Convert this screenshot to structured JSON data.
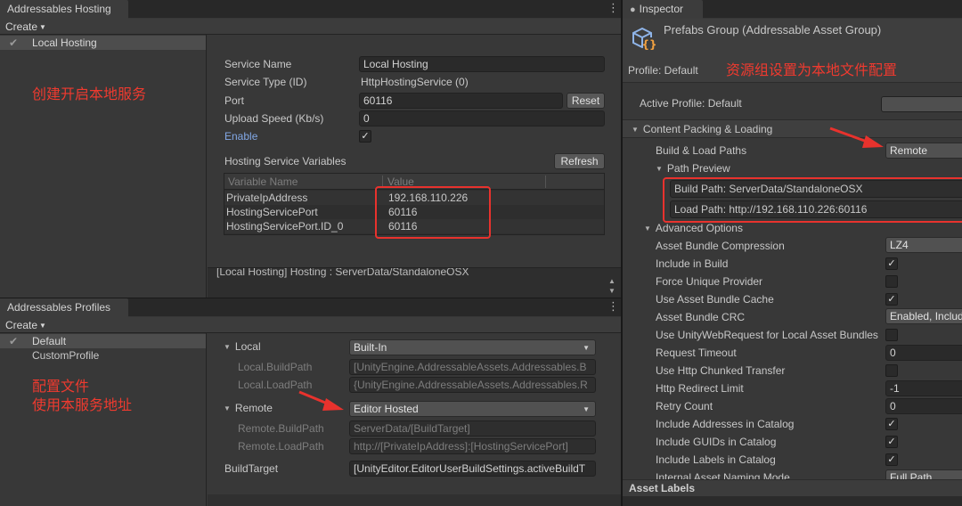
{
  "hosting": {
    "tab": "Addressables Hosting",
    "create": "Create",
    "service_item": "Local Hosting",
    "fields": {
      "service_name_label": "Service Name",
      "service_name_value": "Local Hosting",
      "service_type_label": "Service Type (ID)",
      "service_type_value": "HttpHostingService (0)",
      "port_label": "Port",
      "port_value": "60116",
      "reset_button": "Reset",
      "upload_label": "Upload Speed (Kb/s)",
      "upload_value": "0",
      "enable_label": "Enable"
    },
    "variables_title": "Hosting Service Variables",
    "refresh_button": "Refresh",
    "columns": [
      "Variable Name",
      "Value"
    ],
    "rows": [
      {
        "name": "PrivateIpAddress",
        "value": "192.168.110.226"
      },
      {
        "name": "HostingServicePort",
        "value": "60116"
      },
      {
        "name": "HostingServicePort.ID_0",
        "value": "60116"
      }
    ],
    "log_line": "[Local Hosting] Hosting : ServerData/StandaloneOSX"
  },
  "profiles": {
    "tab": "Addressables Profiles",
    "create": "Create",
    "items": [
      "Default",
      "CustomProfile"
    ],
    "local_label": "Local",
    "local_value": "Built-In",
    "local_build_label": "Local.BuildPath",
    "local_build_value": "[UnityEngine.AddressableAssets.Addressables.B",
    "local_load_label": "Local.LoadPath",
    "local_load_value": "{UnityEngine.AddressableAssets.Addressables.R",
    "remote_label": "Remote",
    "remote_value": "Editor Hosted",
    "remote_build_label": "Remote.BuildPath",
    "remote_build_value": "ServerData/[BuildTarget]",
    "remote_load_label": "Remote.LoadPath",
    "remote_load_value": "http://[PrivateIpAddress]:[HostingServicePort]",
    "buildtarget_label": "BuildTarget",
    "buildtarget_value": "[UnityEditor.EditorUserBuildSettings.activeBuildT"
  },
  "inspector": {
    "tab": "Inspector",
    "title": "Prefabs Group (Addressable Asset Group)",
    "profile": "Profile: Default",
    "active_profile": "Active Profile: Default",
    "content_packing": "Content Packing & Loading",
    "build_load_label": "Build & Load Paths",
    "build_load_value": "Remote",
    "path_preview": "Path Preview",
    "build_path": "Build Path: ServerData/StandaloneOSX",
    "load_path": "Load Path: http://192.168.110.226:60116",
    "advanced": "Advanced Options",
    "options": [
      {
        "label": "Asset Bundle Compression",
        "kind": "dropdown",
        "value": "LZ4"
      },
      {
        "label": "Include in Build",
        "kind": "check",
        "checked": true
      },
      {
        "label": "Force Unique Provider",
        "kind": "check",
        "checked": false
      },
      {
        "label": "Use Asset Bundle Cache",
        "kind": "check",
        "checked": true
      },
      {
        "label": "Asset Bundle CRC",
        "kind": "dropdown",
        "value": "Enabled, Includ"
      },
      {
        "label": "Use UnityWebRequest for Local Asset Bundles",
        "kind": "check",
        "checked": false
      },
      {
        "label": "Request Timeout",
        "kind": "field",
        "value": "0"
      },
      {
        "label": "Use Http Chunked Transfer",
        "kind": "check",
        "checked": false
      },
      {
        "label": "Http Redirect Limit",
        "kind": "field",
        "value": "-1"
      },
      {
        "label": "Retry Count",
        "kind": "field",
        "value": "0"
      },
      {
        "label": "Include Addresses in Catalog",
        "kind": "check",
        "checked": true
      },
      {
        "label": "Include GUIDs in Catalog",
        "kind": "check",
        "checked": true
      },
      {
        "label": "Include Labels in Catalog",
        "kind": "check",
        "checked": true
      },
      {
        "label": "Internal Asset Naming Mode",
        "kind": "dropdown",
        "value": "Full Path"
      }
    ],
    "asset_labels": "Asset Labels"
  },
  "annotations": {
    "hosting_note": "创建开启本地服务",
    "profiles_note_1": "配置文件",
    "profiles_note_2": "使用本服务地址",
    "inspector_note": "资源组设置为本地文件配置"
  },
  "colors": {
    "panel": "#383838",
    "field": "#2a2a2a",
    "annotation_red": "#e8322d",
    "link_blue": "#82a8e6"
  }
}
